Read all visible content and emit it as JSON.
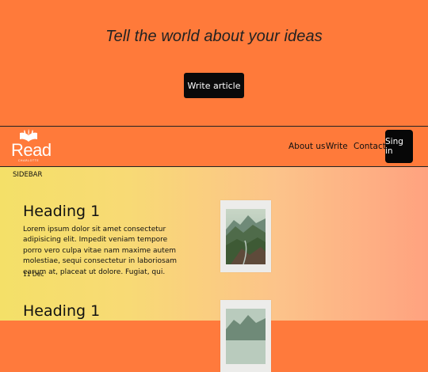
{
  "hero": {
    "title": "Tell the world about your ideas",
    "write_button": "Write article"
  },
  "brand": {
    "name": "Read",
    "tagline": "CHARLOTTE",
    "logo_icon": "book-icon"
  },
  "nav": {
    "about": "About us",
    "write": "Write",
    "contact": "Contact",
    "signin": "Sing in"
  },
  "sidebar": {
    "label": "SIDEBAR"
  },
  "posts": [
    {
      "heading": "Heading 1",
      "body": "Lorem ipsum dolor sit amet consectetur adipisicing elit. Impedit veniam tempore porro vero culpa vitae nam maxime autem molestiae, sequi consectetur in laboriosam earum at, placeat ut dolore. Fugiat, qui.",
      "date": "11 Dec",
      "image": "mountain-landscape-thumbnail"
    },
    {
      "heading": "Heading 1",
      "image": "mountain-landscape-thumbnail"
    }
  ],
  "colors": {
    "header_bg": "#ff7a3a",
    "button_bg": "#0a0a0a",
    "gradient_start": "#f4e068",
    "gradient_end": "#ffa27f"
  }
}
